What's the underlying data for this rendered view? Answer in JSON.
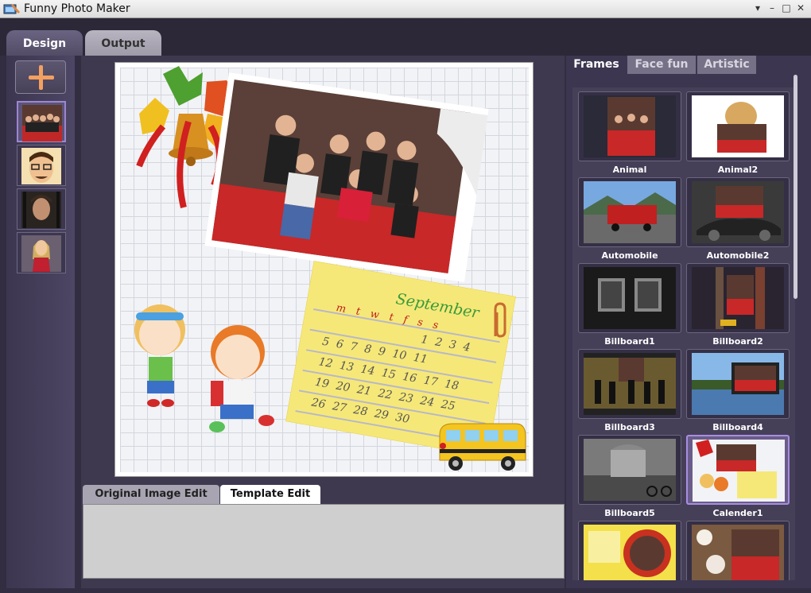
{
  "window": {
    "title": "Funny Photo Maker"
  },
  "main_tabs": [
    {
      "label": "Design"
    },
    {
      "label": "Output"
    }
  ],
  "calendar": {
    "month": "September",
    "days": [
      "m",
      "t",
      "w",
      "t",
      "f",
      "s",
      "s"
    ],
    "rows": [
      [
        "5",
        "6",
        "7",
        "8",
        "9",
        "10",
        "11"
      ],
      [
        "12",
        "13",
        "14",
        "15",
        "16",
        "17",
        "18"
      ],
      [
        "19",
        "20",
        "21",
        "22",
        "23",
        "24",
        "25"
      ],
      [
        "26",
        "27",
        "28",
        "29",
        "30"
      ]
    ],
    "first_row": [
      "1",
      "2",
      "3",
      "4"
    ]
  },
  "edit_tabs": [
    {
      "label": "Original Image Edit"
    },
    {
      "label": "Template Edit"
    }
  ],
  "right_tabs": [
    {
      "label": "Frames"
    },
    {
      "label": "Face fun"
    },
    {
      "label": "Artistic"
    }
  ],
  "frames": [
    {
      "label": "Animal"
    },
    {
      "label": "Animal2"
    },
    {
      "label": "Automobile"
    },
    {
      "label": "Automobile2"
    },
    {
      "label": "Billboard1"
    },
    {
      "label": "Billboard2"
    },
    {
      "label": "Billboard3"
    },
    {
      "label": "Billboard4"
    },
    {
      "label": "Billboard5"
    },
    {
      "label": "Calender1"
    }
  ],
  "colors": {
    "accent": "#a88ee0",
    "plus": "#f4a060",
    "background": "#332d42"
  }
}
